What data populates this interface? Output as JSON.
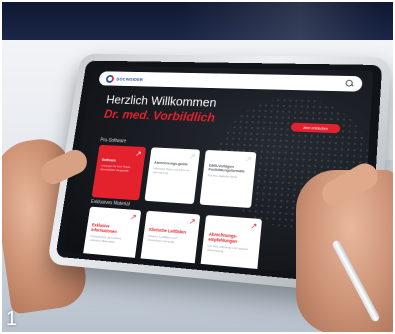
{
  "nav": {
    "logo_text": "DOCINSIDER"
  },
  "hero": {
    "line1": "Herzlich Willkommen",
    "line2": "Dr. med. Vorbildlich",
    "cta_label": "Jetzt entdecken"
  },
  "sections": {
    "pro_software": "Pro-Software",
    "exclusive": "Exklusives Material"
  },
  "software_cards": [
    {
      "title": "Software",
      "desc": "Lösungen für Ihre Praxis, übersichtlich dargestellt"
    },
    {
      "title": "Abrechnungs-guide",
      "desc": "Hilfreiche Tipps und Infos zur Abrechnung"
    },
    {
      "title": "DMS-Vorlagen Fortbildungsformate",
      "desc": "Für Ihre tägliche Arbeit"
    }
  ],
  "material_cards": [
    {
      "title": "Exklusive Informationen",
      "desc": "Fachbeiträge und weitere exklusive Materialien"
    },
    {
      "title": "Klinische Leitfäden",
      "desc": "Wissen, Leitfäden und Checklisten kompakt"
    },
    {
      "title": "Abrechnungs-empfehlungen",
      "desc": "Für eine effiziente und sichere Abrechnung"
    }
  ],
  "caption_number": "1"
}
